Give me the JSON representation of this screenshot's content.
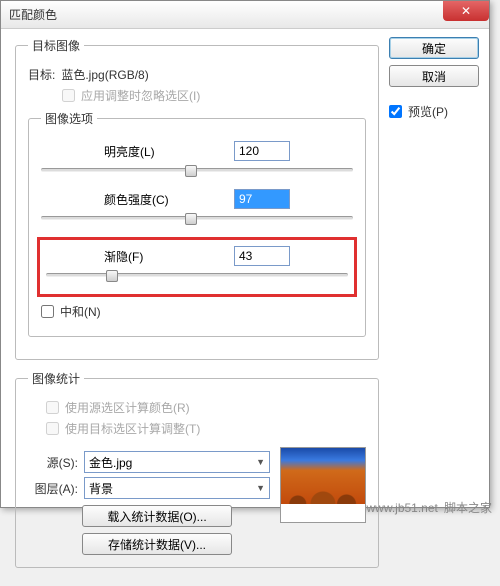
{
  "title": "匹配颜色",
  "buttons": {
    "ok": "确定",
    "cancel": "取消",
    "close": "✕"
  },
  "preview": {
    "label": "预览(P)",
    "checked": true
  },
  "target": {
    "legend": "目标图像",
    "targetPrefix": "目标:",
    "targetValue": "蓝色.jpg(RGB/8)",
    "ignoreSel": {
      "label": "应用调整时忽略选区(I)",
      "checked": false
    }
  },
  "options": {
    "legend": "图像选项",
    "sliders": {
      "luminance": {
        "label": "明亮度(L)",
        "value": "120",
        "pct": 48
      },
      "intensity": {
        "label": "颜色强度(C)",
        "value": "97",
        "pct": 48,
        "selected": true
      },
      "fade": {
        "label": "渐隐(F)",
        "value": "43",
        "pct": 22
      }
    },
    "neutralize": {
      "label": "中和(N)",
      "checked": false
    }
  },
  "stats": {
    "legend": "图像统计",
    "useSourceSel": {
      "label": "使用源选区计算颜色(R)",
      "checked": false
    },
    "useTargetSel": {
      "label": "使用目标选区计算调整(T)",
      "checked": false
    },
    "source": {
      "label": "源(S):",
      "value": "金色.jpg"
    },
    "layer": {
      "label": "图层(A):",
      "value": "背景"
    },
    "load": "载入统计数据(O)...",
    "save": "存储统计数据(V)..."
  },
  "footer": {
    "site": "www.jb51.net",
    "name": "脚本之家"
  }
}
